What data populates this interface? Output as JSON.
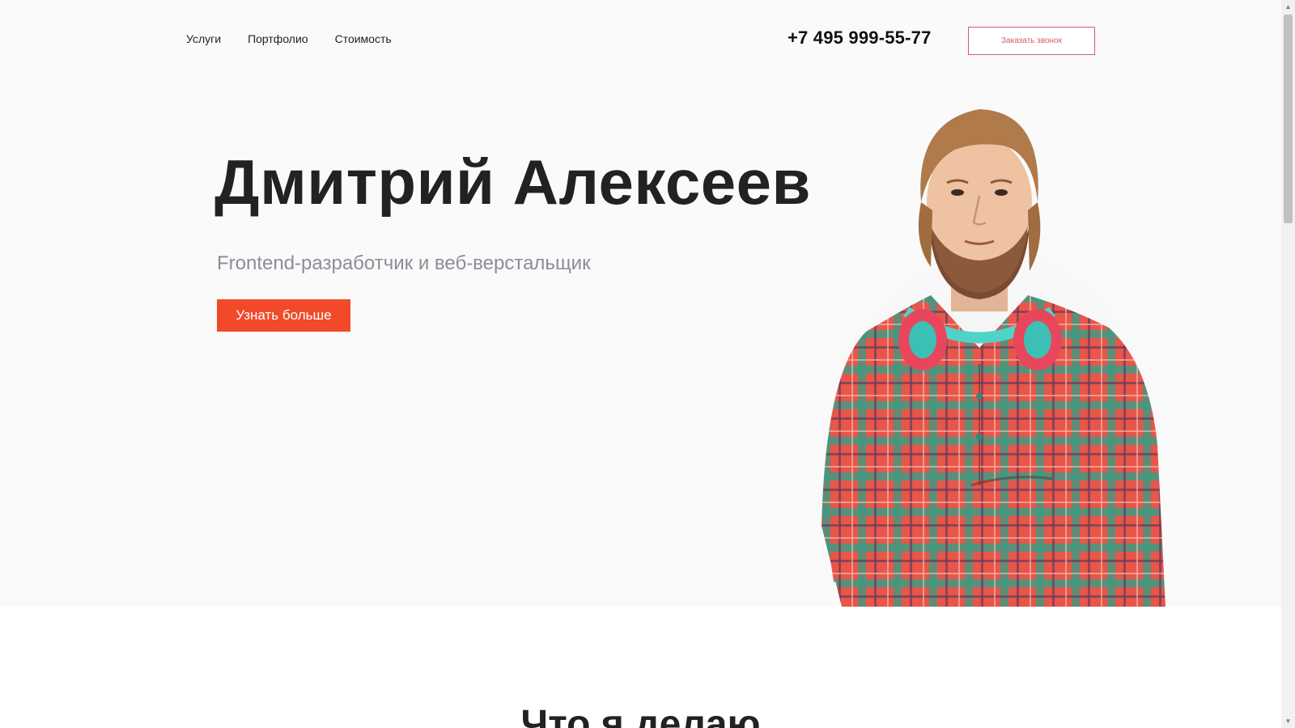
{
  "nav": {
    "items": [
      "Услуги",
      "Портфолио",
      "Стоимость"
    ]
  },
  "header": {
    "phone": "+7 495 999-55-77",
    "callback_label": "Заказать звонок"
  },
  "hero": {
    "name": "Дмитрий Алексеев",
    "subtitle": "Frontend-разработчик и веб-верстальщик",
    "cta_label": "Узнать больше"
  },
  "section": {
    "title": "Что я делаю"
  },
  "colors": {
    "accent": "#f04a2a",
    "callback_border": "#d65a6a",
    "hero_bg": "#fafafa",
    "subtitle": "#8a8e97"
  },
  "icons": {
    "scroll_up": "chevron-up-icon",
    "scroll_down": "chevron-down-icon"
  }
}
